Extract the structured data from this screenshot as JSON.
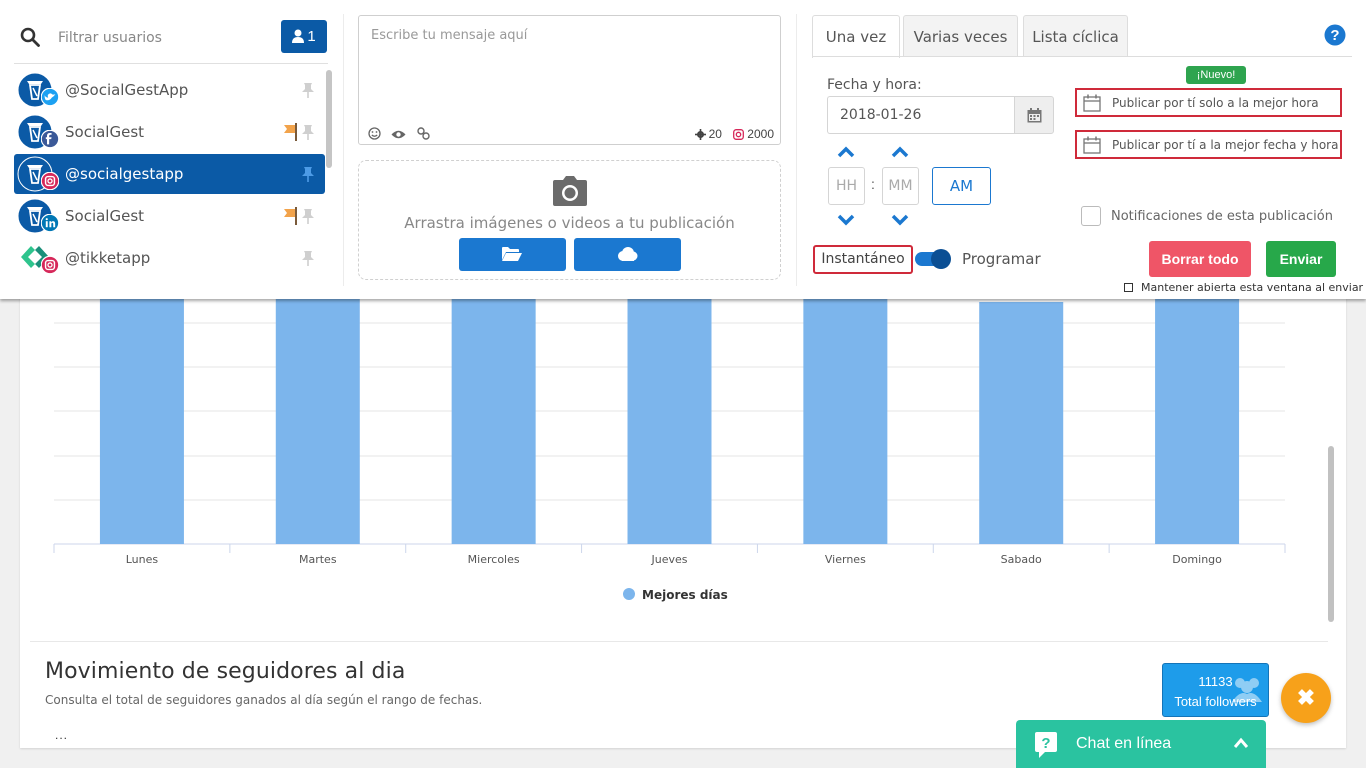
{
  "accounts_panel": {
    "search_placeholder": "Filtrar usuarios",
    "selected_count": "1",
    "accounts": [
      {
        "name": "@SocialGestApp",
        "network": "twitter",
        "selected": false,
        "flag": false
      },
      {
        "name": "SocialGest",
        "network": "facebook",
        "selected": false,
        "flag": true
      },
      {
        "name": "@socialgestapp",
        "network": "instagram",
        "selected": true,
        "flag": false
      },
      {
        "name": "SocialGest",
        "network": "linkedin",
        "selected": false,
        "flag": true
      },
      {
        "name": "@tikketapp",
        "network": "instagram",
        "selected": false,
        "flag": false
      }
    ]
  },
  "message": {
    "placeholder": "Escribe tu mensaje aquí",
    "hashtag_count": "20",
    "char_count": "2000"
  },
  "media": {
    "drop_text": "Arrastra imágenes o videos a tu publicación"
  },
  "schedule": {
    "tabs": [
      "Una vez",
      "Varias veces",
      "Lista cíclica"
    ],
    "active_tab": 0,
    "date_label": "Fecha y hora:",
    "date_value": "2018-01-26",
    "hour_placeholder": "HH",
    "minute_placeholder": "MM",
    "ampm": "AM",
    "instant_label": "Instantáneo",
    "program_label": "Programar",
    "toggle_on": true,
    "new_badge": "¡Nuevo!",
    "best_hour_label": "Publicar por tí solo a la mejor hora",
    "best_date_label": "Publicar por tí a la mejor fecha y hora",
    "notifications_label": "Notificaciones de esta publicación",
    "clear_button": "Borrar todo",
    "send_button": "Enviar",
    "keep_open_label": "Mantener abierta esta ventana al enviar"
  },
  "chart_data": {
    "type": "bar",
    "categories": [
      "Lunes",
      "Martes",
      "Miercoles",
      "Jueves",
      "Viernes",
      "Sabado",
      "Domingo"
    ],
    "series": [
      {
        "name": "Mejores días",
        "values": [
          100,
          100,
          100,
          100,
          100,
          99,
          100
        ],
        "color": "#7cb5ec"
      }
    ]
  },
  "followers_section": {
    "title": "Movimiento de seguidores al dia",
    "subtitle": "Consulta el total de seguidores ganados al día según el rango de fechas.",
    "dots": "...",
    "total_followers_value": "11133",
    "total_followers_label": "Total followers"
  },
  "chat": {
    "label": "Chat en línea"
  },
  "colors": {
    "primary": "#0b5aa6",
    "accent_blue": "#1b78d0",
    "danger": "#ef5567",
    "success": "#27a84a",
    "chat": "#2ac3a0",
    "fab": "#f7a11a",
    "bar": "#7cb5ec"
  }
}
